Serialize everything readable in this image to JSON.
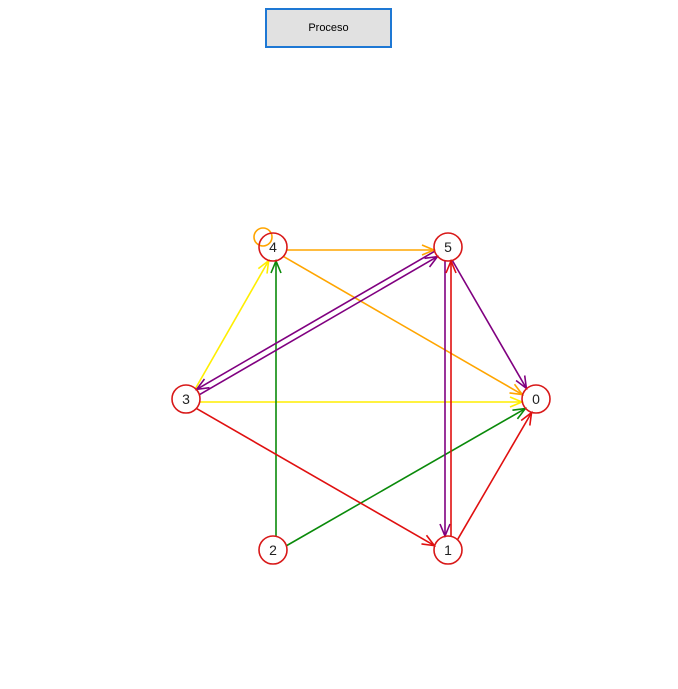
{
  "window": {
    "button_label": "Proceso"
  },
  "graph": {
    "node_color": "#d81818",
    "nodes": [
      {
        "id": "node-0",
        "label": "0"
      },
      {
        "id": "node-1",
        "label": "1"
      },
      {
        "id": "node-2",
        "label": "2"
      },
      {
        "id": "node-3",
        "label": "3"
      },
      {
        "id": "node-4",
        "label": "4"
      },
      {
        "id": "node-5",
        "label": "5"
      }
    ],
    "edges": [
      {
        "from": "node-3",
        "to": "node-4",
        "color": "#ffee00"
      },
      {
        "from": "node-3",
        "to": "node-0",
        "color": "#ffee00"
      },
      {
        "from": "node-4",
        "to": "node-5",
        "color": "#ffa500"
      },
      {
        "from": "node-4",
        "to": "node-0",
        "color": "#ffa500"
      },
      {
        "from": "node-4",
        "to": "node-4",
        "color": "#ffa500"
      },
      {
        "from": "node-2",
        "to": "node-4",
        "color": "#0a8a0a"
      },
      {
        "from": "node-2",
        "to": "node-0",
        "color": "#0a8a0a"
      },
      {
        "from": "node-3",
        "to": "node-5",
        "color": "#800080"
      },
      {
        "from": "node-5",
        "to": "node-3",
        "color": "#800080"
      },
      {
        "from": "node-5",
        "to": "node-0",
        "color": "#800080"
      },
      {
        "from": "node-5",
        "to": "node-1",
        "color": "#800080"
      },
      {
        "from": "node-3",
        "to": "node-1",
        "color": "#e01010"
      },
      {
        "from": "node-1",
        "to": "node-5",
        "color": "#e01010"
      },
      {
        "from": "node-1",
        "to": "node-0",
        "color": "#e01010"
      }
    ]
  }
}
